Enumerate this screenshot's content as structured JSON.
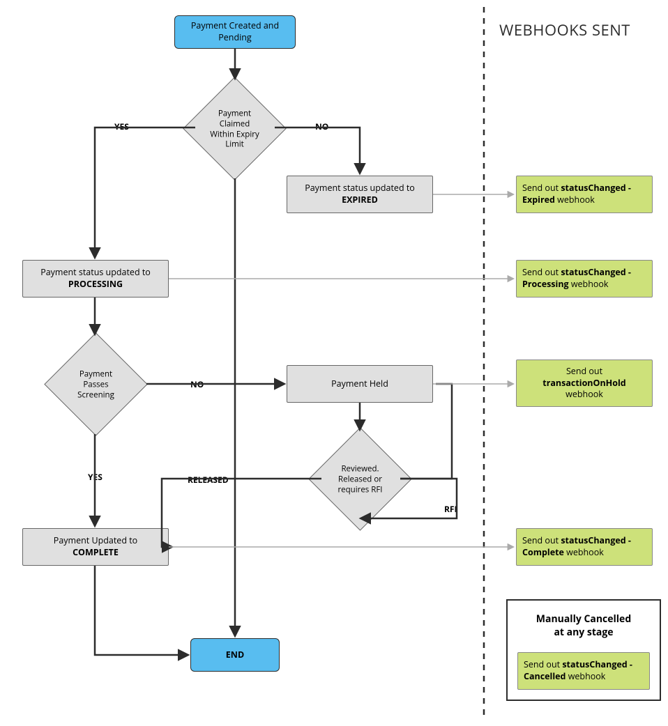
{
  "header": "WEBHOOKS SENT",
  "nodes": {
    "start": {
      "line1": "Payment Created and",
      "line2": "Pending"
    },
    "end": "END",
    "expired": {
      "pre": "Payment status updated to",
      "bold": "EXPIRED"
    },
    "processing": {
      "pre": "Payment status updated to",
      "bold": "PROCESSING"
    },
    "held": "Payment Held",
    "complete": {
      "pre": "Payment Updated to",
      "bold": "COMPLETE"
    },
    "claimed": "Payment Claimed Within Expiry Limit",
    "screening": "Payment Passes Screening",
    "reviewed": "Reviewed. Released or requires RFI"
  },
  "webhooks": {
    "expired": {
      "pre": "Send out ",
      "bold": "statusChanged - Expired",
      "post": " webhook"
    },
    "processing": {
      "pre": "Send out ",
      "bold": "statusChanged - Processing",
      "post": " webhook"
    },
    "onhold": {
      "pre": "Send out ",
      "bold": "transactionOnHold",
      "post": " webhook"
    },
    "complete": {
      "pre": "Send out ",
      "bold": "statusChanged - Complete",
      "post": " webhook"
    },
    "cancelled": {
      "pre": "Send out ",
      "bold": "statusChanged - Cancelled",
      "post": " webhook"
    }
  },
  "labels": {
    "yes1": "YES",
    "no1": "NO",
    "yes2": "YES",
    "no2": "NO",
    "released": "RELEASED",
    "rfi": "RFI"
  },
  "cancelBox": {
    "title1": "Manually Cancelled",
    "title2": "at any stage"
  }
}
